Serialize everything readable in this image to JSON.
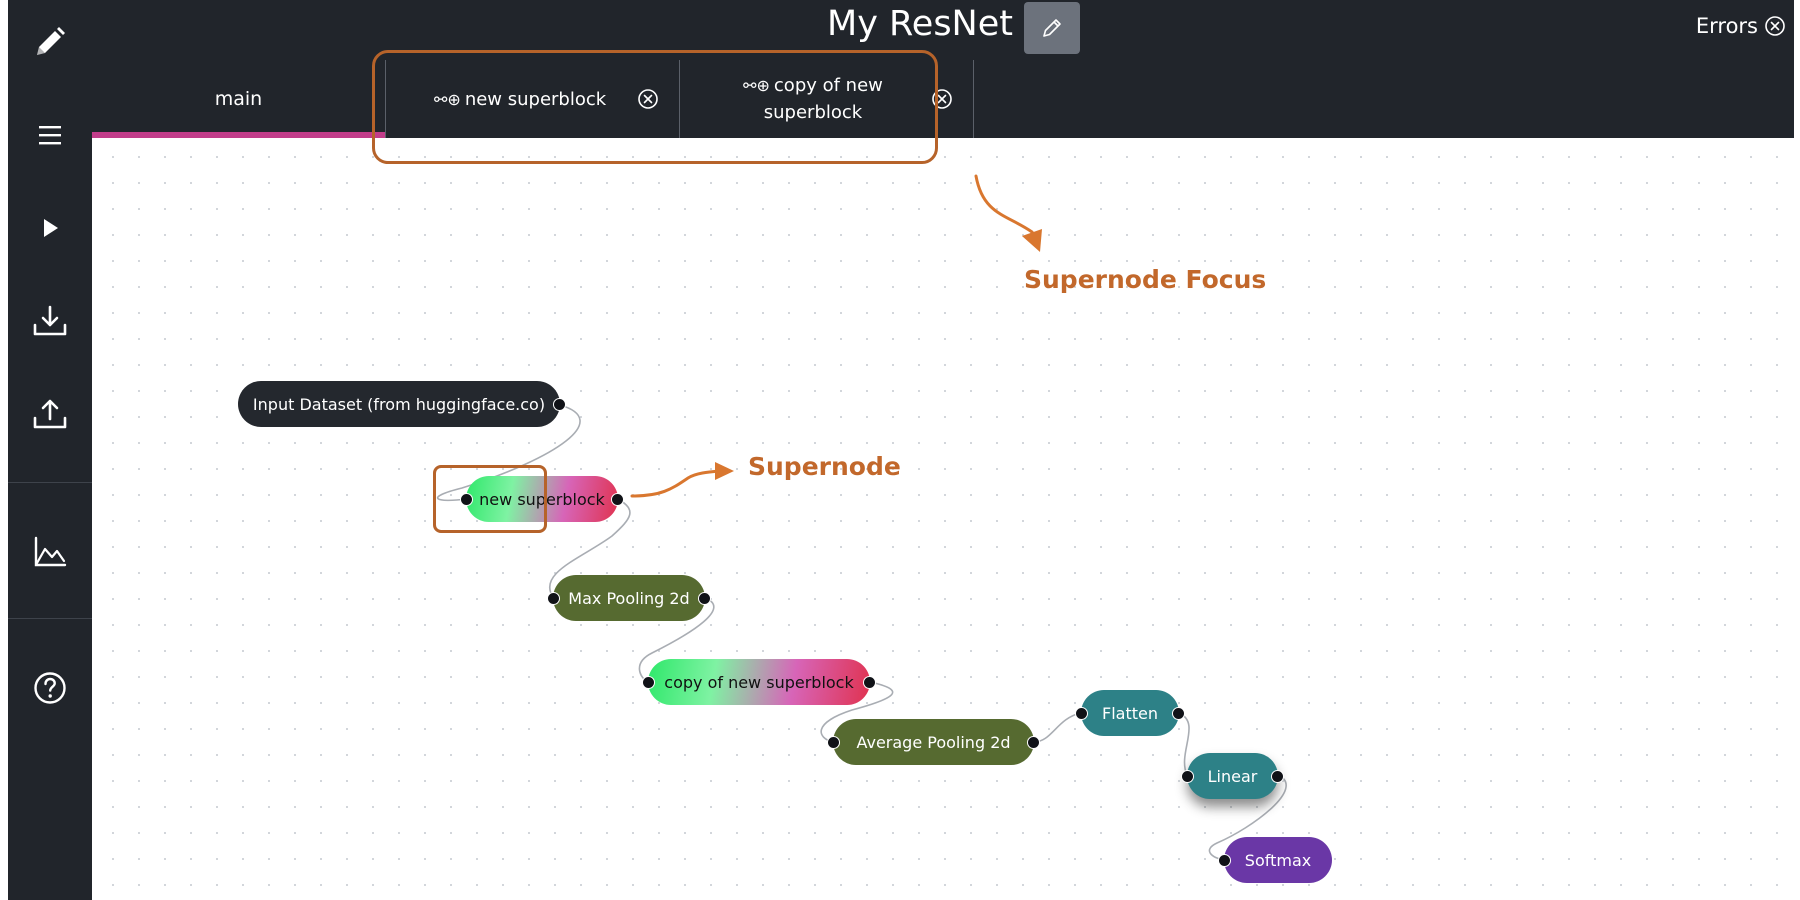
{
  "header": {
    "title": "My ResNet",
    "edit_icon": "pencil-icon",
    "errors_label": "Errors",
    "errors_icon": "close-circle-icon"
  },
  "sidebar": {
    "items": [
      {
        "name": "edit",
        "icon": "pencil-icon"
      },
      {
        "name": "menu",
        "icon": "hamburger-menu-icon"
      },
      {
        "name": "run",
        "icon": "play-icon"
      },
      {
        "name": "download",
        "icon": "download-icon"
      },
      {
        "name": "upload",
        "icon": "upload-icon"
      },
      {
        "name": "chart",
        "icon": "line-chart-icon"
      },
      {
        "name": "help",
        "icon": "help-circle-icon"
      }
    ]
  },
  "tabs": [
    {
      "label": "main",
      "active": true
    },
    {
      "label": "new superblock",
      "icon": "link-icon",
      "closable": true
    },
    {
      "label": "copy of new superblock",
      "icon": "link-icon",
      "closable": true
    }
  ],
  "nodes": [
    {
      "id": "input-dataset",
      "label": "Input Dataset (from huggingface.co)",
      "color": "#24282e"
    },
    {
      "id": "new-superblock",
      "label": "new superblock",
      "color": "gradient"
    },
    {
      "id": "max-pooling-2d",
      "label": "Max Pooling 2d",
      "color": "#566a30"
    },
    {
      "id": "copy-superblock",
      "label": "copy of new superblock",
      "color": "gradient"
    },
    {
      "id": "avg-pooling-2d",
      "label": "Average Pooling 2d",
      "color": "#566a30"
    },
    {
      "id": "flatten",
      "label": "Flatten",
      "color": "#2d8187"
    },
    {
      "id": "linear",
      "label": "Linear",
      "color": "#2d8187"
    },
    {
      "id": "softmax",
      "label": "Softmax",
      "color": "#6a37a6"
    }
  ],
  "annotations": {
    "supernode_focus": "Supernode Focus",
    "supernode": "Supernode",
    "color": "#c2682b"
  },
  "colors": {
    "chrome": "#21252b",
    "active_tab_underline": "#c23d8a"
  }
}
